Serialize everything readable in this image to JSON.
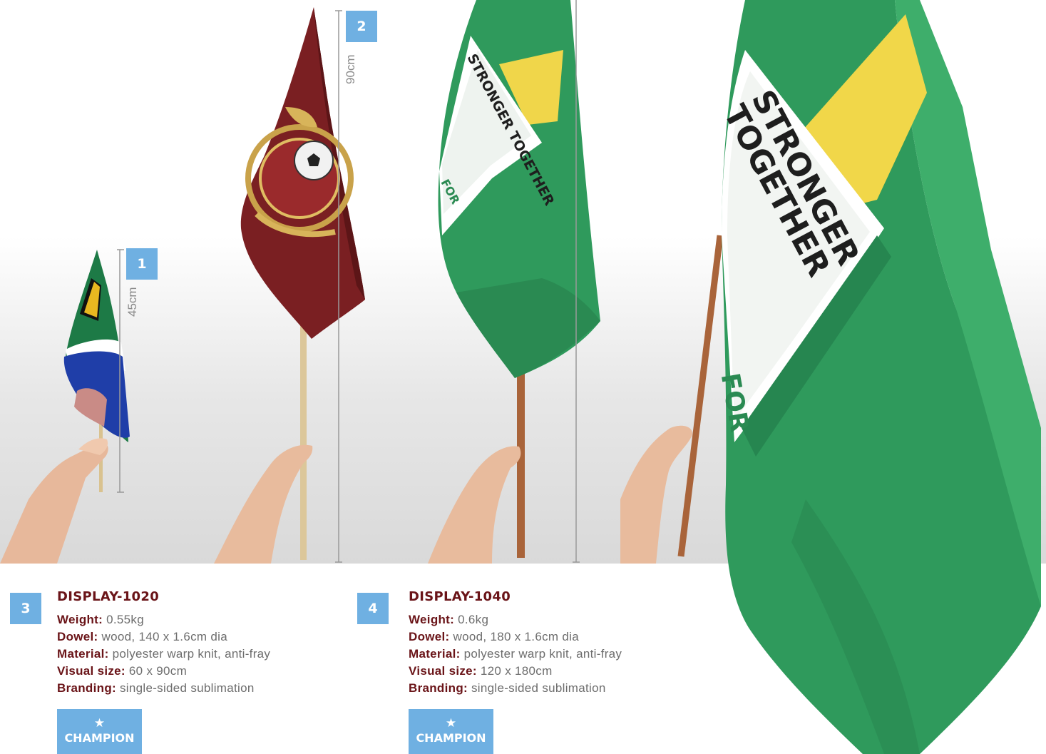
{
  "callouts": [
    "1",
    "2",
    "3",
    "4"
  ],
  "dimensions": [
    "45cm",
    "90cm"
  ],
  "flag_texts": {
    "stronger_together": "STRONGER TOGETHER",
    "for": "FOR"
  },
  "products": [
    {
      "code": "DISPLAY-1020",
      "weight_label": "Weight:",
      "weight": " 0.55kg",
      "dowel_label": "Dowel:",
      "dowel": " wood, 140 x 1.6cm dia",
      "material_label": "Material:",
      "material": " polyester warp knit, anti-fray",
      "visual_label": "Visual size:",
      "visual": " 60 x 90cm",
      "branding_label": "Branding:",
      "branding": " single-sided sublimation",
      "badge": "CHAMPION"
    },
    {
      "code": "DISPLAY-1040",
      "weight_label": "Weight:",
      "weight": " 0.6kg",
      "dowel_label": "Dowel:",
      "dowel": " wood, 180 x 1.6cm dia",
      "material_label": "Material:",
      "material": " polyester warp knit, anti-fray",
      "visual_label": "Visual size:",
      "visual": " 120 x 180cm",
      "branding_label": "Branding:",
      "branding": " single-sided sublimation",
      "badge": "CHAMPION"
    }
  ],
  "colors": {
    "accent_blue": "#6fb0e2",
    "title_maroon": "#6a1418",
    "flag_green": "#2f9a5c",
    "flag_maroon": "#7a1f22",
    "flag_yellow": "#f0d64a"
  },
  "icons": [
    "star-icon"
  ]
}
